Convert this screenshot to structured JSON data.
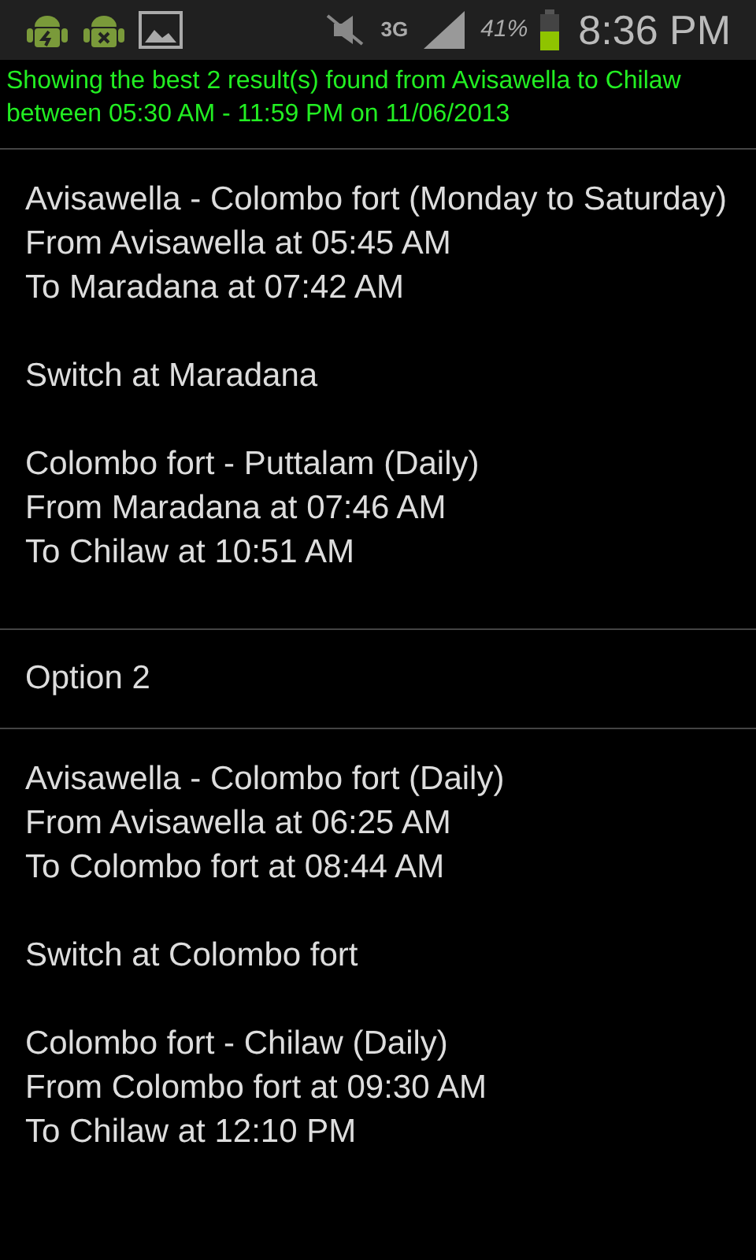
{
  "status_bar": {
    "battery": "41%",
    "network": "3G",
    "time": "8:36 PM"
  },
  "summary": "Showing the best 2 result(s) found from Avisawella to Chilaw between 05:30 AM - 11:59 PM on 11/06/2013",
  "results": [
    {
      "kind": "route",
      "paragraphs": [
        [
          "Avisawella - Colombo fort (Monday to Saturday)",
          "From Avisawella at 05:45 AM",
          "To Maradana at 07:42 AM"
        ],
        [
          "Switch at Maradana"
        ],
        [
          "Colombo fort - Puttalam (Daily)",
          "From Maradana at 07:46 AM",
          "To Chilaw at 10:51 AM"
        ]
      ]
    },
    {
      "kind": "header",
      "text": "Option 2"
    },
    {
      "kind": "route",
      "paragraphs": [
        [
          "Avisawella - Colombo fort (Daily)",
          "From Avisawella at 06:25 AM",
          "To Colombo fort at 08:44 AM"
        ],
        [
          "Switch at Colombo fort"
        ],
        [
          "Colombo fort - Chilaw (Daily)",
          "From Colombo fort at 09:30 AM",
          "To Chilaw at 12:10 PM"
        ]
      ]
    }
  ]
}
